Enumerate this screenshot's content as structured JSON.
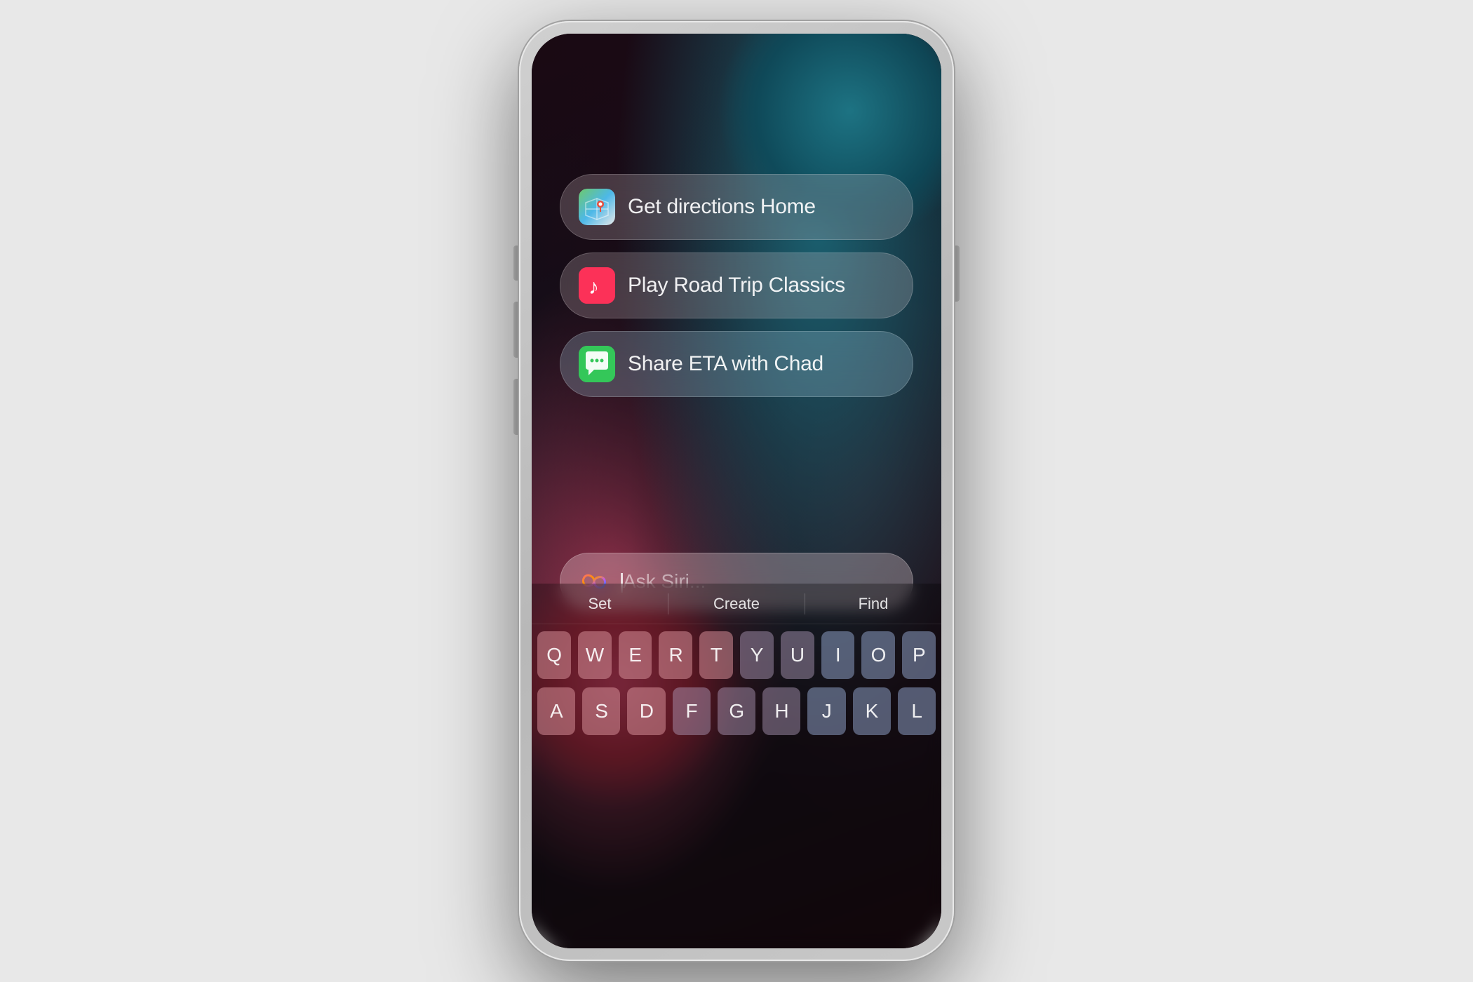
{
  "phone": {
    "screen": {
      "suggestions": [
        {
          "id": "get-directions",
          "icon_type": "maps",
          "label": "Get directions Home"
        },
        {
          "id": "play-music",
          "icon_type": "music",
          "label": "Play Road Trip Classics"
        },
        {
          "id": "share-eta",
          "icon_type": "messages",
          "label": "Share ETA with Chad"
        }
      ],
      "siri_placeholder": "Ask Siri...",
      "keyboard": {
        "suggestions": [
          "Set",
          "Create",
          "Find"
        ],
        "rows": [
          [
            "Q",
            "W",
            "E",
            "R",
            "T",
            "Y",
            "U",
            "I",
            "O",
            "P"
          ],
          [
            "A",
            "S",
            "D",
            "F",
            "G",
            "H",
            "J",
            "K",
            "L"
          ]
        ]
      }
    }
  }
}
